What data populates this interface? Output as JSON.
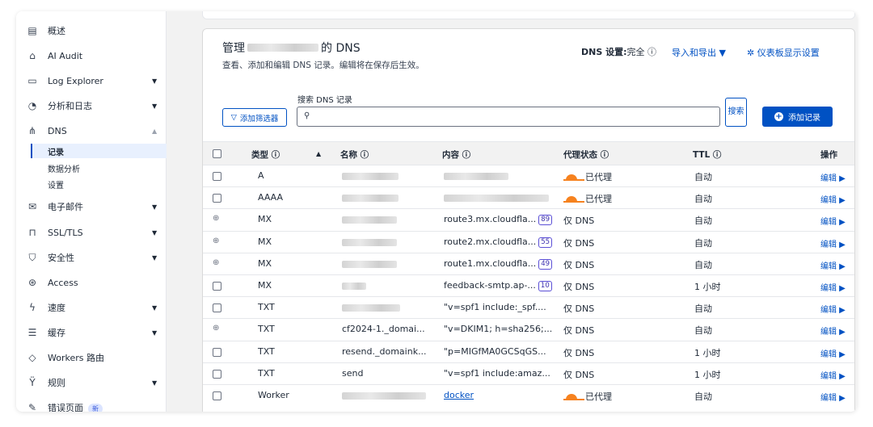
{
  "sidebar": {
    "items": [
      {
        "label": "概述",
        "icon": "document-icon",
        "chevron": false
      },
      {
        "label": "AI Audit",
        "icon": "ai-audit-icon",
        "chevron": false
      },
      {
        "label": "Log Explorer",
        "icon": "log-explorer-icon",
        "chevron": true
      },
      {
        "label": "分析和日志",
        "icon": "analytics-icon",
        "chevron": true
      },
      {
        "label": "DNS",
        "icon": "dns-icon",
        "chevron": true,
        "expanded": true
      },
      {
        "label": "电子邮件",
        "icon": "email-icon",
        "chevron": true
      },
      {
        "label": "SSL/TLS",
        "icon": "lock-icon",
        "chevron": true
      },
      {
        "label": "安全性",
        "icon": "shield-icon",
        "chevron": true
      },
      {
        "label": "Access",
        "icon": "access-icon",
        "chevron": false
      },
      {
        "label": "速度",
        "icon": "lightning-icon",
        "chevron": true
      },
      {
        "label": "缓存",
        "icon": "cache-icon",
        "chevron": true
      },
      {
        "label": "Workers 路由",
        "icon": "workers-icon",
        "chevron": false
      },
      {
        "label": "规则",
        "icon": "rules-icon",
        "chevron": true
      },
      {
        "label": "错误页面",
        "icon": "error-page-icon",
        "chevron": false,
        "badge": "新"
      }
    ],
    "dns_sub": [
      "记录",
      "数据分析",
      "设置"
    ]
  },
  "header": {
    "title_prefix": "管理",
    "title_suffix": "的 DNS",
    "subtitle": "查看、添加和编辑 DNS 记录。编辑将在保存后生效。",
    "dns_setting_label": "DNS 设置:",
    "dns_setting_value": "完全 ⓘ",
    "import_export": "导入和导出 ▼",
    "dashboard_settings": "仪表板显示设置"
  },
  "toolbar": {
    "search_label": "搜索 DNS 记录",
    "search_placeholder": "",
    "filter_label": "添加筛选器",
    "search_button": "搜索",
    "add_record": "添加记录"
  },
  "table": {
    "headers": {
      "type": "类型 ⓘ",
      "name": "名称 ⓘ",
      "content": "内容 ⓘ",
      "proxy": "代理状态 ⓘ",
      "ttl": "TTL ⓘ",
      "actions": "操作"
    },
    "rows": [
      {
        "locked": false,
        "type": "A",
        "name": "",
        "content": "",
        "proxy": "已代理",
        "proxied": true,
        "ttl": "自动",
        "edit": "编辑 ▶"
      },
      {
        "locked": false,
        "type": "AAAA",
        "name": "",
        "content": "",
        "proxy": "已代理",
        "proxied": true,
        "ttl": "自动",
        "edit": "编辑 ▶"
      },
      {
        "locked": true,
        "type": "MX",
        "name": "",
        "content": "route3.mx.cloudfla...",
        "count": "89",
        "proxy": "仅 DNS",
        "proxied": false,
        "ttl": "自动",
        "edit": "编辑 ▶"
      },
      {
        "locked": true,
        "type": "MX",
        "name": "",
        "content": "route2.mx.cloudfla...",
        "count": "55",
        "proxy": "仅 DNS",
        "proxied": false,
        "ttl": "自动",
        "edit": "编辑 ▶"
      },
      {
        "locked": true,
        "type": "MX",
        "name": "",
        "content": "route1.mx.cloudfla...",
        "count": "49",
        "proxy": "仅 DNS",
        "proxied": false,
        "ttl": "自动",
        "edit": "编辑 ▶"
      },
      {
        "locked": false,
        "type": "MX",
        "name": "",
        "content": "feedback-smtp.ap-...",
        "count": "10",
        "proxy": "仅 DNS",
        "proxied": false,
        "ttl": "1 小时",
        "edit": "编辑 ▶"
      },
      {
        "locked": false,
        "type": "TXT",
        "name": "",
        "content": "\"v=spf1 include:_spf....",
        "proxy": "仅 DNS",
        "proxied": false,
        "ttl": "自动",
        "edit": "编辑 ▶"
      },
      {
        "locked": true,
        "type": "TXT",
        "name": "cf2024-1._domai...",
        "content": "\"v=DKIM1; h=sha256;...",
        "proxy": "仅 DNS",
        "proxied": false,
        "ttl": "自动",
        "edit": "编辑 ▶"
      },
      {
        "locked": false,
        "type": "TXT",
        "name": "resend._domaink...",
        "content": "\"p=MIGfMA0GCSqGS...",
        "proxy": "仅 DNS",
        "proxied": false,
        "ttl": "1 小时",
        "edit": "编辑 ▶"
      },
      {
        "locked": false,
        "type": "TXT",
        "name": "send",
        "content": "\"v=spf1 include:amaz...",
        "proxy": "仅 DNS",
        "proxied": false,
        "ttl": "1 小时",
        "edit": "编辑 ▶"
      },
      {
        "locked": false,
        "type": "Worker",
        "name": "",
        "content": "docker",
        "content_link": true,
        "proxy": "已代理",
        "proxied": true,
        "ttl": "自动",
        "edit": "编辑 ▶"
      }
    ]
  },
  "colors": {
    "accent": "#0051c3",
    "proxy_orange": "#f6821f"
  }
}
